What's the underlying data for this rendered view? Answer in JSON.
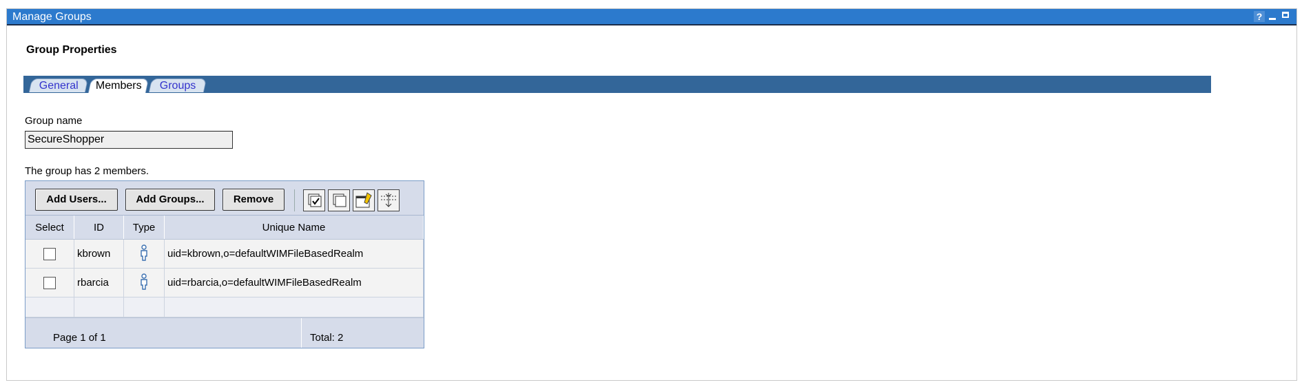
{
  "window": {
    "title": "Manage Groups",
    "help_label": "?"
  },
  "page": {
    "section_title": "Group Properties"
  },
  "tabs": [
    {
      "label": "General"
    },
    {
      "label": "Members",
      "active": true
    },
    {
      "label": "Groups"
    }
  ],
  "group_name": {
    "label": "Group name",
    "value": "SecureShopper"
  },
  "members_summary": "The group has 2 members.",
  "toolbar": {
    "add_users": "Add Users...",
    "add_groups": "Add Groups...",
    "remove": "Remove",
    "icons": [
      "select-all-icon",
      "deselect-all-icon",
      "show-filter-icon",
      "clear-filter-icon"
    ]
  },
  "table": {
    "columns": [
      "Select",
      "ID",
      "Type",
      "Unique Name"
    ],
    "rows": [
      {
        "id": "kbrown",
        "type": "user",
        "unique_name": "uid=kbrown,o=defaultWIMFileBasedRealm",
        "selected": false
      },
      {
        "id": "rbarcia",
        "type": "user",
        "unique_name": "uid=rbarcia,o=defaultWIMFileBasedRealm",
        "selected": false
      }
    ],
    "page_info": "Page 1 of 1",
    "total": "Total: 2"
  },
  "colors": {
    "title_bar": "#2c7acd",
    "tab_bar": "#336699",
    "table_header": "#d6dcea",
    "tab_link": "#3333cc"
  }
}
